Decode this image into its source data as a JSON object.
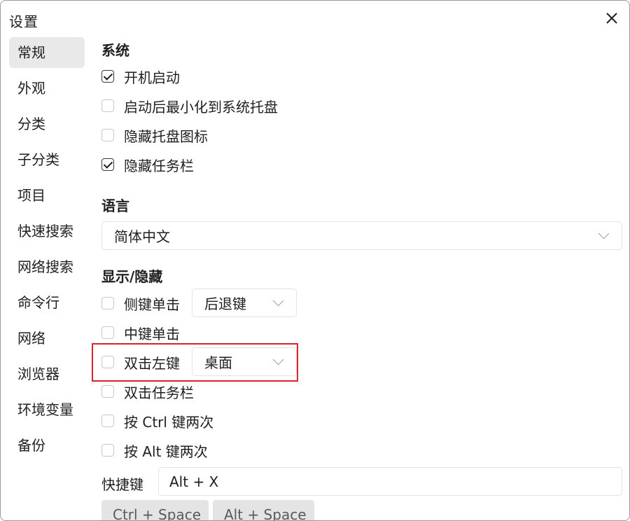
{
  "window": {
    "title": "设置"
  },
  "sidebar": {
    "items": [
      {
        "label": "常规",
        "active": true
      },
      {
        "label": "外观"
      },
      {
        "label": "分类"
      },
      {
        "label": "子分类"
      },
      {
        "label": "项目"
      },
      {
        "label": "快速搜索"
      },
      {
        "label": "网络搜索"
      },
      {
        "label": "命令行"
      },
      {
        "label": "网络"
      },
      {
        "label": "浏览器"
      },
      {
        "label": "环境变量"
      },
      {
        "label": "备份"
      }
    ]
  },
  "system": {
    "title": "系统",
    "options": [
      {
        "label": "开机启动",
        "checked": true
      },
      {
        "label": "启动后最小化到系统托盘",
        "checked": false
      },
      {
        "label": "隐藏托盘图标",
        "checked": false
      },
      {
        "label": "隐藏任务栏",
        "checked": true
      }
    ]
  },
  "language": {
    "title": "语言",
    "selected": "简体中文"
  },
  "display": {
    "title": "显示/隐藏",
    "side_click": {
      "label": "侧键单击",
      "checked": false,
      "action": "后退键"
    },
    "middle_click": {
      "label": "中键单击",
      "checked": false
    },
    "double_left": {
      "label": "双击左键",
      "checked": false,
      "action": "桌面"
    },
    "double_taskbar": {
      "label": "双击任务栏",
      "checked": false
    },
    "ctrl_twice": {
      "label": "按 Ctrl 键两次",
      "checked": false
    },
    "alt_twice": {
      "label": "按 Alt 键两次",
      "checked": false
    },
    "hotkey_label": "快捷键",
    "hotkey_value": "Alt + X",
    "hotkey_presets": [
      "Ctrl + Space",
      "Alt + Space"
    ]
  },
  "colors": {
    "highlight_border": "#d9222b",
    "sidebar_active_bg": "#e9e9e9"
  }
}
